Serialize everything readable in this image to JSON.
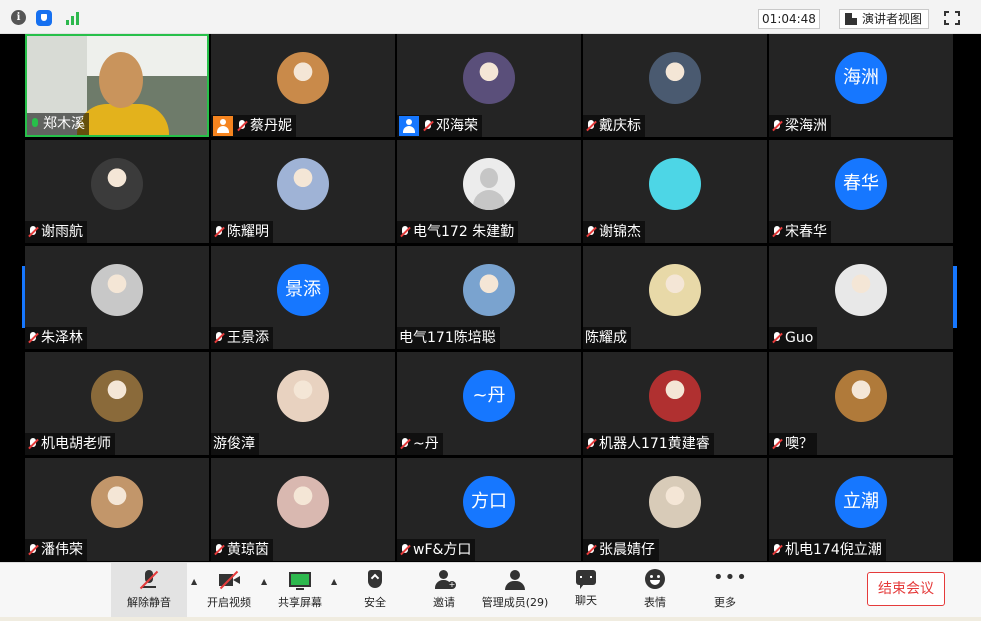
{
  "topbar": {
    "timer": "01:04:48",
    "speaker_view_label": "演讲者视图",
    "icons": [
      "info-icon",
      "shield-icon",
      "signal-icon",
      "fullscreen-icon"
    ]
  },
  "participants": [
    {
      "name": "郑木溪",
      "mic": "on",
      "avatar_type": "video"
    },
    {
      "name": "蔡丹妮",
      "mic": "muted",
      "badge": "orange",
      "avatar_type": "photo",
      "avatar_color": "#c98a4a"
    },
    {
      "name": "邓海荣",
      "mic": "muted",
      "badge": "blue",
      "avatar_type": "photo",
      "avatar_color": "#5a4f7a"
    },
    {
      "name": "戴庆标",
      "mic": "muted",
      "avatar_type": "photo",
      "avatar_color": "#4a5a70"
    },
    {
      "name": "梁海洲",
      "mic": "muted",
      "avatar_type": "text",
      "avatar_text": "海洲"
    },
    {
      "name": "谢雨航",
      "mic": "muted",
      "avatar_type": "photo",
      "avatar_color": "#3b3b3b"
    },
    {
      "name": "陈耀明",
      "mic": "muted",
      "avatar_type": "photo",
      "avatar_color": "#9fb3d6"
    },
    {
      "name": "电气172 朱建勤",
      "mic": "muted",
      "avatar_type": "default"
    },
    {
      "name": "谢锦杰",
      "mic": "muted",
      "avatar_type": "cyan"
    },
    {
      "name": "宋春华",
      "mic": "muted",
      "avatar_type": "text",
      "avatar_text": "春华"
    },
    {
      "name": "朱泽林",
      "mic": "muted",
      "avatar_type": "photo",
      "avatar_color": "#c8c8c8"
    },
    {
      "name": "王景添",
      "mic": "muted",
      "avatar_type": "text",
      "avatar_text": "景添"
    },
    {
      "name": "电气171陈培聪",
      "mic": "none",
      "avatar_type": "photo",
      "avatar_color": "#7aa3cf"
    },
    {
      "name": "陈耀成",
      "mic": "none",
      "avatar_type": "photo",
      "avatar_color": "#e8d9a8"
    },
    {
      "name": "Guo",
      "mic": "muted",
      "avatar_type": "photo",
      "avatar_color": "#e8e8e8"
    },
    {
      "name": "机电胡老师",
      "mic": "muted",
      "avatar_type": "photo",
      "avatar_color": "#8a6a3a"
    },
    {
      "name": "游俊漳",
      "mic": "none",
      "avatar_type": "photo",
      "avatar_color": "#e8d2c0"
    },
    {
      "name": "~丹",
      "mic": "muted",
      "avatar_type": "text",
      "avatar_text": "~丹"
    },
    {
      "name": "机器人171黄建睿",
      "mic": "muted",
      "avatar_type": "photo",
      "avatar_color": "#b03030"
    },
    {
      "name": "噢？",
      "mic": "muted",
      "avatar_type": "photo",
      "avatar_color": "#b07a3a"
    },
    {
      "name": "潘伟荣",
      "mic": "muted",
      "avatar_type": "photo",
      "avatar_color": "#c2966a"
    },
    {
      "name": "黄琼茵",
      "mic": "muted",
      "avatar_type": "photo",
      "avatar_color": "#d9b8b0"
    },
    {
      "name": "wF&方口",
      "mic": "muted",
      "avatar_type": "text",
      "avatar_text": "方口"
    },
    {
      "name": "张晨婧仔",
      "mic": "muted",
      "avatar_type": "photo",
      "avatar_color": "#d8cbb8"
    },
    {
      "name": "机电174倪立潮",
      "mic": "muted",
      "avatar_type": "text",
      "avatar_text": "立潮"
    }
  ],
  "pager": {
    "prev_glyph": "◀",
    "next_glyph": "▶"
  },
  "toolbar": {
    "unmute_label": "解除静音",
    "video_label": "开启视频",
    "share_label": "共享屏幕",
    "security_label": "安全",
    "invite_label": "邀请",
    "manage_label": "管理成员(29)",
    "chat_label": "聊天",
    "reactions_label": "表情",
    "more_label": "更多",
    "end_label": "结束会议",
    "caret": "▲"
  },
  "colors": {
    "accent": "#1677ff",
    "end": "#e53b3b",
    "active_speaker": "#27c04a"
  }
}
